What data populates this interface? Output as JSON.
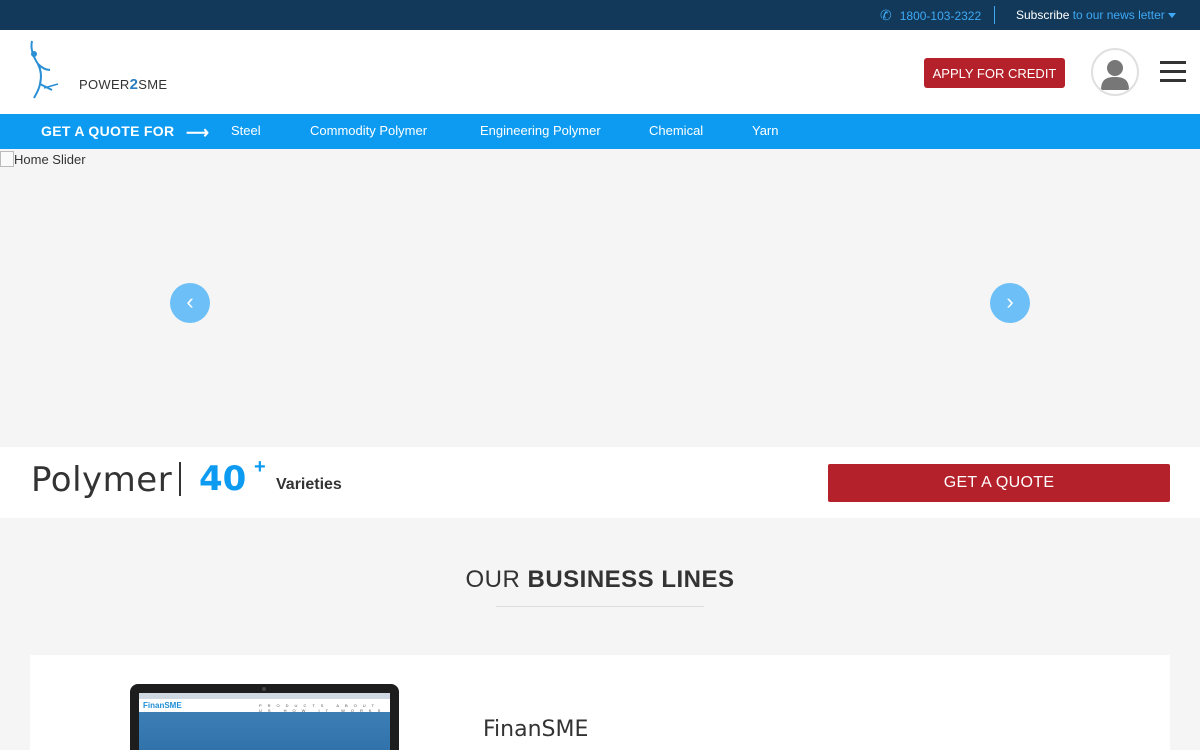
{
  "topbar": {
    "phone_icon": "phone-icon",
    "phone": "1800-103-2322",
    "subscribe_bold": "Subscribe",
    "subscribe_rest": "to our news letter"
  },
  "header": {
    "logo_text_pre": "POWER",
    "logo_text_num": "2",
    "logo_text_post": "SME",
    "apply_button": "APPLY FOR CREDIT",
    "avatar_icon": "user-avatar-icon",
    "menu_icon": "hamburger-menu-icon"
  },
  "quote_nav": {
    "label": "GET A QUOTE FOR",
    "arrow": "⟶",
    "items": [
      {
        "label": "Steel"
      },
      {
        "label": "Commodity Polymer"
      },
      {
        "label": "Engineering Polymer"
      },
      {
        "label": "Chemical"
      },
      {
        "label": "Yarn"
      }
    ]
  },
  "slider": {
    "alt_text": "Home Slider",
    "prev": "‹",
    "next": "›"
  },
  "highlight": {
    "title": "Polymer",
    "count": "40",
    "plus": "+",
    "varieties": "Varieties",
    "quote_button": "GET A QUOTE"
  },
  "business": {
    "heading_light": "OUR",
    "heading_bold": "BUSINESS LINES",
    "cards": [
      {
        "title": "FinanSME",
        "screen_brand": "FinanSME",
        "screen_links": "PRODUCTS ABOUT US HOW IT WORKS FAQS"
      }
    ]
  },
  "colors": {
    "topbar": "#12395a",
    "accent_blue": "#0d9bf2",
    "brand_red": "#b5212a"
  }
}
